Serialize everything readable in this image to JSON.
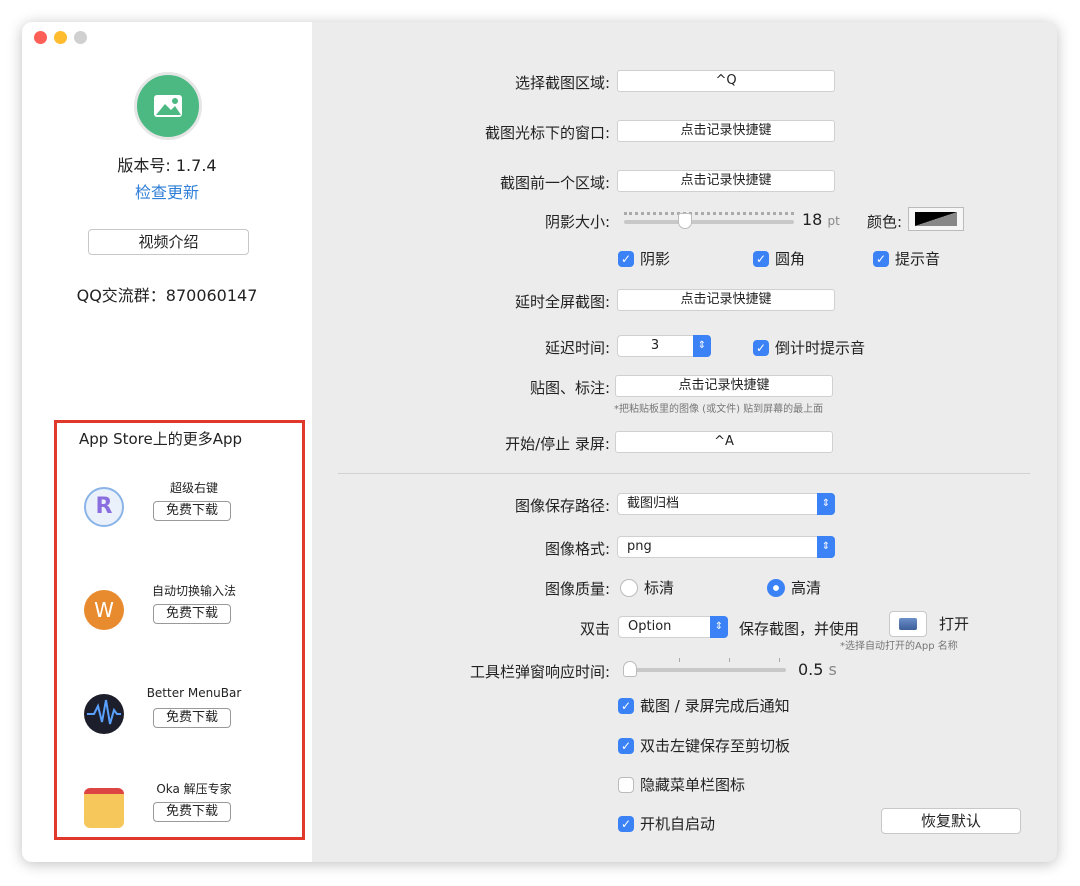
{
  "sidebar": {
    "version": "版本号: 1.7.4",
    "check_update": "检查更新",
    "video_intro": "视频介绍",
    "qq_group": "QQ交流群：870060147",
    "more_apps_title": "App Store上的更多App",
    "apps": [
      {
        "name": "超级右键",
        "download": "免费下载"
      },
      {
        "name": "自动切换输入法",
        "download": "免费下载"
      },
      {
        "name": "Better MenuBar",
        "download": "免费下载"
      },
      {
        "name": "Oka 解压专家",
        "download": "免费下载"
      }
    ]
  },
  "settings": {
    "select_area": {
      "label": "选择截图区域:",
      "value": "^Q"
    },
    "window_under_cursor": {
      "label": "截图光标下的窗口:",
      "value": "点击记录快捷键"
    },
    "previous_area": {
      "label": "截图前一个区域:",
      "value": "点击记录快捷键"
    },
    "shadow_size": {
      "label": "阴影大小:",
      "value": "18",
      "unit": "pt",
      "level": 0.3
    },
    "color": {
      "label": "颜色:"
    },
    "checks1": [
      {
        "label": "阴影",
        "checked": true
      },
      {
        "label": "圆角",
        "checked": true
      },
      {
        "label": "提示音",
        "checked": true
      }
    ],
    "delayed_fullscreen": {
      "label": "延时全屏截图:",
      "value": "点击记录快捷键"
    },
    "delay_time": {
      "label": "延迟时间:",
      "value": "3"
    },
    "countdown_sound": {
      "label": "倒计时提示音",
      "checked": true
    },
    "pin": {
      "label": "贴图、标注:",
      "value": "点击记录快捷键",
      "note": "*把粘贴板里的图像 (或文件) 贴到屏幕的最上面"
    },
    "record": {
      "label": "开始/停止 录屏:",
      "value": "^A"
    },
    "save_path": {
      "label": "图像保存路径:",
      "value": "截图归档"
    },
    "format": {
      "label": "图像格式:",
      "value": "png"
    },
    "quality": {
      "label": "图像质量:",
      "options": [
        {
          "label": "标清",
          "selected": false
        },
        {
          "label": "高清",
          "selected": true
        }
      ]
    },
    "double_click": {
      "label": "双击",
      "key": "Option",
      "middle": "保存截图，并使用",
      "open": "打开",
      "note": "*选择自动打开的App 名称"
    },
    "toolbar_delay": {
      "label": "工具栏弹窗响应时间:",
      "value": "0.5",
      "unit": "s",
      "level": 0
    },
    "options": [
      {
        "label": "截图 / 录屏完成后通知",
        "checked": true
      },
      {
        "label": "双击左键保存至剪切板",
        "checked": true
      },
      {
        "label": "隐藏菜单栏图标",
        "checked": false
      },
      {
        "label": "开机自启动",
        "checked": true
      }
    ],
    "restore": "恢复默认"
  }
}
